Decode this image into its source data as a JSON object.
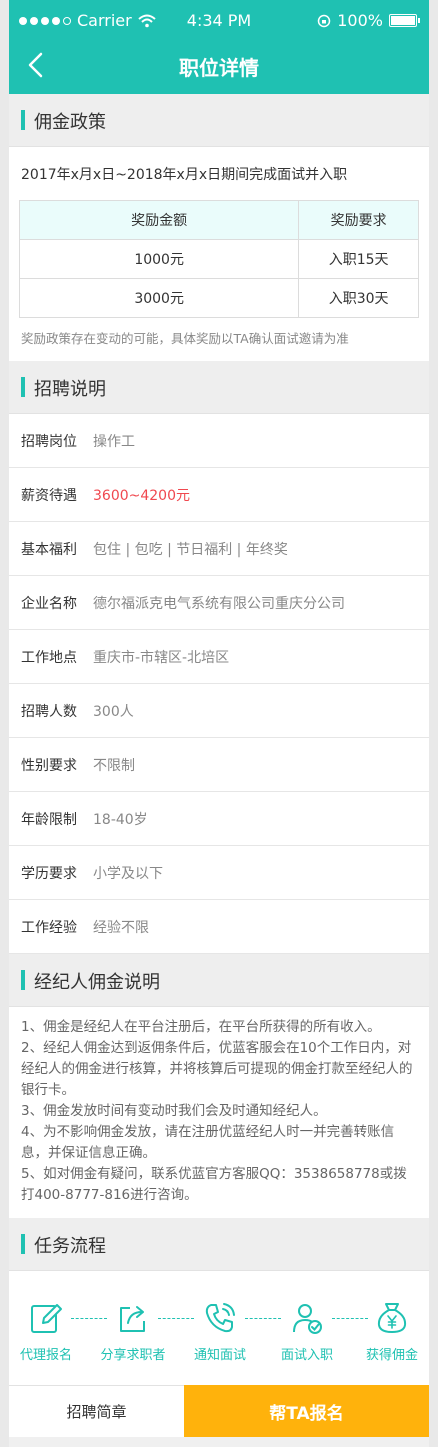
{
  "status_bar": {
    "carrier": "Carrier",
    "time": "4:34 PM",
    "battery": "100%"
  },
  "nav": {
    "title": "职位详情"
  },
  "policy": {
    "heading": "佣金政策",
    "period": "2017年x月x日~2018年x月x日期间完成面试并入职",
    "table_headers": [
      "奖励金额",
      "奖励要求"
    ],
    "rows": [
      {
        "amount": "1000元",
        "requirement": "入职15天"
      },
      {
        "amount": "3000元",
        "requirement": "入职30天"
      }
    ],
    "note": "奖励政策存在变动的可能，具体奖励以TA确认面试邀请为准"
  },
  "recruit": {
    "heading": "招聘说明",
    "items": [
      {
        "label": "招聘岗位",
        "value": "操作工"
      },
      {
        "label": "薪资待遇",
        "value": "3600~4200元"
      },
      {
        "label": "基本福利",
        "value": "包住 | 包吃 | 节日福利 | 年终奖"
      },
      {
        "label": "企业名称",
        "value": "德尔福派克电气系统有限公司重庆分公司"
      },
      {
        "label": "工作地点",
        "value": "重庆市-市辖区-北培区"
      },
      {
        "label": "招聘人数",
        "value": "300人"
      },
      {
        "label": "性别要求",
        "value": "不限制"
      },
      {
        "label": "年龄限制",
        "value": "18-40岁"
      },
      {
        "label": "学历要求",
        "value": "小学及以下"
      },
      {
        "label": "工作经验",
        "value": "经验不限"
      }
    ]
  },
  "agent": {
    "heading": "经纪人佣金说明",
    "lines": [
      "1、佣金是经纪人在平台注册后，在平台所获得的所有收入。",
      "2、经纪人佣金达到返佣条件后，优蓝客服会在10个工作日内，对经纪人的佣金进行核算，并将核算后可提现的佣金打款至经纪人的银行卡。",
      "3、佣金发放时间有变动时我们会及时通知经纪人。",
      "4、为不影响佣金发放，请在注册优蓝经纪人时一并完善转账信息，并保证信息正确。",
      "5、如对佣金有疑问，联系优蓝官方客服QQ：3538658778或拨打400-8777-816进行咨询。"
    ]
  },
  "flow": {
    "heading": "任务流程",
    "steps": [
      {
        "label": "代理报名",
        "icon": "edit-icon"
      },
      {
        "label": "分享求职者",
        "icon": "share-icon"
      },
      {
        "label": "通知面试",
        "icon": "phone-icon"
      },
      {
        "label": "面试入职",
        "icon": "user-check-icon"
      },
      {
        "label": "获得佣金",
        "icon": "money-bag-icon"
      }
    ]
  },
  "footer": {
    "brochure": "招聘简章",
    "signup": "帮TA报名"
  },
  "colors": {
    "accent": "#1fc1b2",
    "cta": "#ffb20c",
    "salary": "#f0484f"
  }
}
